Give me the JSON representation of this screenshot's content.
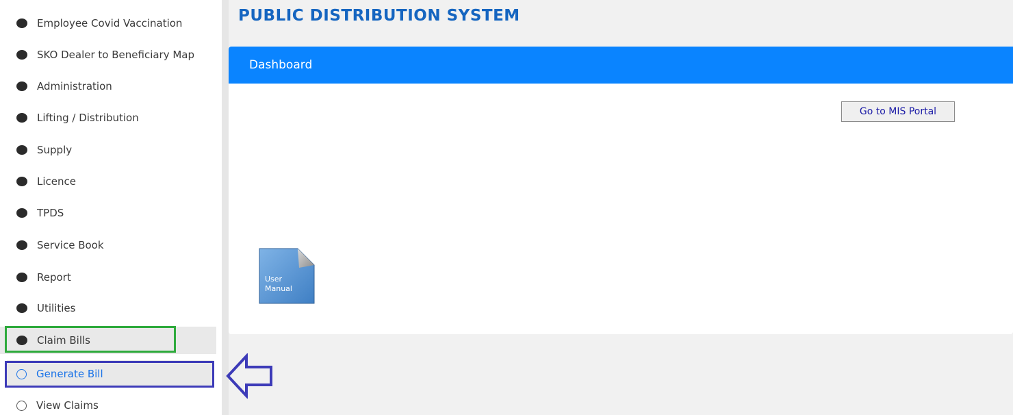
{
  "header": {
    "title": "PUBLIC DISTRIBUTION SYSTEM"
  },
  "sidebar": {
    "items": [
      {
        "label": "Employee Covid Vaccination"
      },
      {
        "label": "SKO Dealer to Beneficiary Map"
      },
      {
        "label": "Administration"
      },
      {
        "label": "Lifting / Distribution"
      },
      {
        "label": "Supply"
      },
      {
        "label": "Licence"
      },
      {
        "label": "TPDS"
      },
      {
        "label": "Service Book"
      },
      {
        "label": "Report"
      },
      {
        "label": "Utilities"
      },
      {
        "label": "Claim Bills"
      }
    ],
    "subitems": [
      {
        "label": "Generate Bill",
        "active": true
      },
      {
        "label": "View Claims",
        "active": false
      }
    ]
  },
  "card": {
    "header": "Dashboard",
    "mis_button": "Go to MIS Portal",
    "manual_icon": {
      "name": "user-manual-icon",
      "line1": "User",
      "line2": "Manual"
    }
  },
  "colors": {
    "accent": "#0a84ff",
    "title": "#1565c0",
    "annotation_green": "#2eaa3c",
    "annotation_blue": "#3d3bb8"
  }
}
